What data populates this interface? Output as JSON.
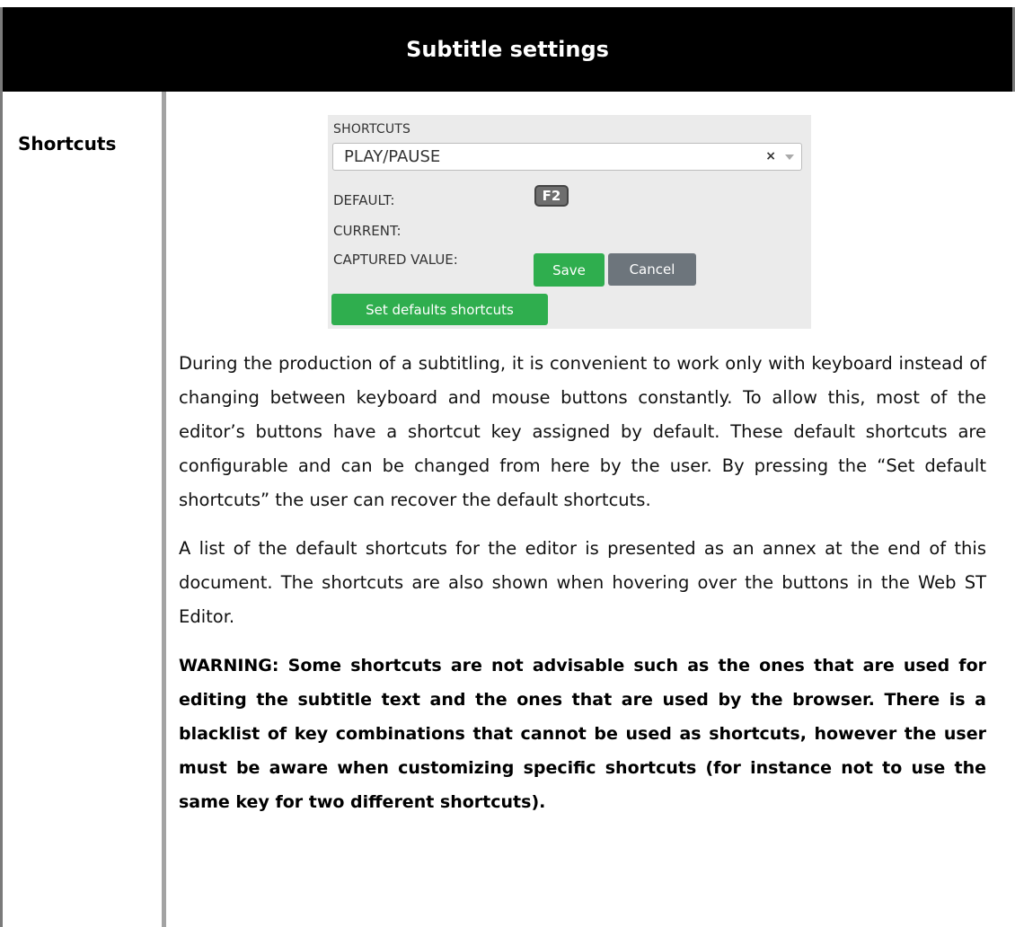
{
  "header": {
    "title": "Subtitle settings"
  },
  "row": {
    "label": "Shortcuts"
  },
  "panel": {
    "heading": "SHORTCUTS",
    "select": {
      "value": "PLAY/PAUSE",
      "clear_symbol": "×"
    },
    "default_label": "DEFAULT:",
    "default_key": "F2",
    "current_label": "CURRENT:",
    "captured_label": "CAPTURED VALUE:",
    "save_label": "Save",
    "cancel_label": "Cancel",
    "set_defaults_label": "Set defaults shortcuts",
    "colors": {
      "panel_bg": "#ebebeb",
      "green": "#2fae4e",
      "gray_button": "#6d757c",
      "key_badge": "#6e6e6e"
    }
  },
  "body": {
    "paragraph1": "During the production of a subtitling, it is convenient to work only with keyboard instead of changing between keyboard and mouse buttons constantly. To allow this, most of the editor’s buttons have a shortcut key assigned by default. These default shortcuts are configurable and can be changed from here by the user. By pressing the “Set default shortcuts” the user can recover the default shortcuts.",
    "paragraph2": "A list of the default shortcuts for the editor is presented as an annex at the end of this document. The shortcuts are also shown when hovering over the buttons in the Web ST Editor.",
    "warning": "WARNING: Some shortcuts are not advisable such as the ones that are used for editing the subtitle text and the ones that are used by the browser. There is a blacklist of key combinations that cannot be used as shortcuts, however the user must be aware when customizing specific shortcuts (for instance not to use the same key for two different shortcuts)."
  }
}
